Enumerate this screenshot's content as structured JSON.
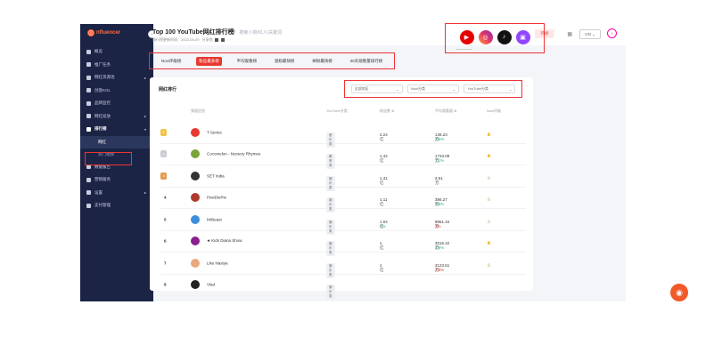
{
  "app": {
    "logo": "nfluencer",
    "search_placeholder": "搜索人物/红人/关键词",
    "hot_label": "热榜",
    "language": "CN"
  },
  "sidebar": {
    "items": [
      {
        "label": "概览",
        "has_arrow": false
      },
      {
        "label": "推广任务",
        "has_arrow": false
      },
      {
        "label": "网红资源池",
        "has_arrow": true
      },
      {
        "label": "创意KOL",
        "has_arrow": false
      },
      {
        "label": "品牌监控",
        "has_arrow": false
      },
      {
        "label": "网红投放",
        "has_arrow": true
      },
      {
        "label": "排行榜",
        "has_arrow": true,
        "active": true
      }
    ],
    "sub_items": [
      {
        "label": "网红",
        "current": true
      },
      {
        "label": "热门视频",
        "current": false
      }
    ],
    "items_after": [
      {
        "label": "数据报告",
        "has_arrow": false
      },
      {
        "label": "营销服务",
        "has_arrow": false
      },
      {
        "label": "设置",
        "has_arrow": true
      },
      {
        "label": "支付管理",
        "has_arrow": false
      }
    ]
  },
  "page": {
    "title": "Top 100 YouTube网红排行榜",
    "update_label": "排行榜更新时间：2022-05-09",
    "share_label": "分享到"
  },
  "platforms": [
    {
      "name": "youtube-icon",
      "glyph": "▶",
      "active": true
    },
    {
      "name": "instagram-icon",
      "glyph": "◎",
      "active": false
    },
    {
      "name": "tiktok-icon",
      "glyph": "♪",
      "active": false
    },
    {
      "name": "twitch-icon",
      "glyph": "▣",
      "active": false
    }
  ],
  "tabs": [
    {
      "label": "Noxi评级榜",
      "active": false
    },
    {
      "label": "粉丝最多榜",
      "active": true
    },
    {
      "label": "平均观看榜",
      "active": false
    },
    {
      "label": "涨粉最快榜",
      "active": false
    },
    {
      "label": "掉粉最快榜",
      "active": false
    },
    {
      "label": "30天观看量排行榜",
      "active": false
    }
  ],
  "card": {
    "title": "网红排行",
    "filters": [
      "全部地区",
      "Noxi分类",
      "YouTube分类"
    ]
  },
  "table": {
    "headers": [
      "",
      "频道信息",
      "YouTube分类",
      "粉丝数 ⊕",
      "平均观看量 ⊕",
      "Noxi评级"
    ],
    "rows": [
      {
        "rank": "1",
        "name": "T-Series",
        "avatar_color": "#e8392f",
        "category": "音乐类",
        "subs": "2.24亿",
        "subs_change": "-",
        "subs_trend": "none",
        "views": "136.23万",
        "views_change": "↑ 3.5%",
        "views_trend": "up",
        "stars": 5
      },
      {
        "rank": "2",
        "name": "Cocomelon - Nursery Rhymes",
        "avatar_color": "#7aa33a",
        "category": "教育类",
        "subs": "1.42亿",
        "subs_change": "-",
        "subs_trend": "none",
        "views": "1733.08万",
        "views_change": "↑ 1.1%",
        "views_trend": "up",
        "stars": 5
      },
      {
        "rank": "3",
        "name": "SET India",
        "avatar_color": "#333333",
        "category": "娱乐类",
        "subs": "1.41亿",
        "subs_change": "-",
        "subs_trend": "none",
        "views": "3.51万",
        "views_change": "-",
        "views_trend": "none",
        "stars": 3
      },
      {
        "rank": "4",
        "name": "PewDiePie",
        "avatar_color": "#b0392b",
        "category": "娱乐类",
        "subs": "1.11亿",
        "subs_change": "-",
        "subs_trend": "none",
        "views": "386.27万",
        "views_change": "↑ 0.8%",
        "views_trend": "up",
        "stars": 4
      },
      {
        "rank": "5",
        "name": "MrBeast",
        "avatar_color": "#3b8edb",
        "category": "娱乐类",
        "subs": "1.04亿",
        "subs_change": "↑ 1%",
        "subs_trend": "up",
        "views": "8951.34万",
        "views_change": "↓ 3%",
        "views_trend": "down",
        "stars": 3
      },
      {
        "rank": "6",
        "name": "★ Kids Diana Show",
        "avatar_color": "#8a1f8f",
        "category": "娱乐类",
        "subs": "1亿",
        "subs_change": "-",
        "subs_trend": "none",
        "views": "3315.42万",
        "views_change": "↑ 4.9%",
        "views_trend": "up",
        "stars": 5
      },
      {
        "rank": "7",
        "name": "Like Nastya",
        "avatar_color": "#e9a77d",
        "category": "娱乐类",
        "subs": "1亿",
        "subs_change": "-",
        "subs_trend": "none",
        "views": "2123.51万",
        "views_change": "↓ 2.8%",
        "views_trend": "down",
        "stars": 4
      },
      {
        "rank": "8",
        "name": "Vlad",
        "avatar_color": "#222222",
        "category": "娱乐类",
        "subs": "",
        "subs_change": "",
        "subs_trend": "none",
        "views": "",
        "views_change": "",
        "views_trend": "none",
        "stars": 0
      }
    ]
  },
  "colors": {
    "sidebar_bg": "#1c2446",
    "accent": "#e8392f",
    "highlight_box": "#ee3333",
    "star": "#f0b400",
    "up": "#2bb673",
    "down": "#ee3333"
  }
}
